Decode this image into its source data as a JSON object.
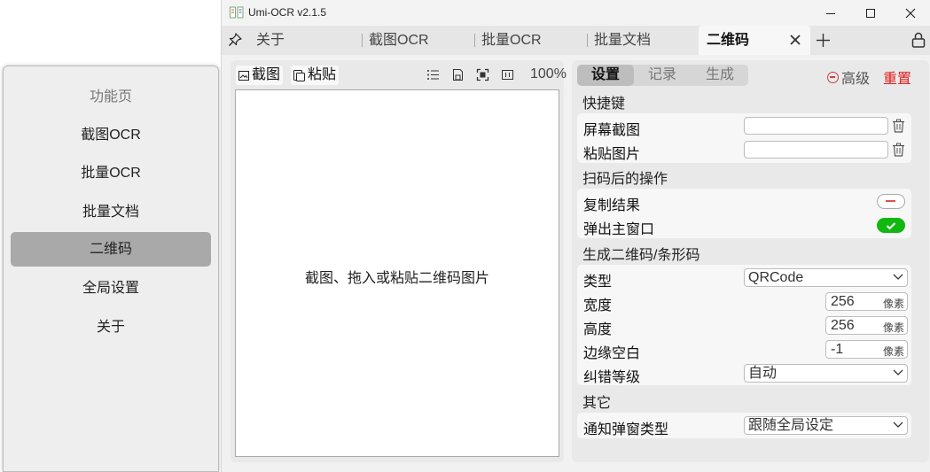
{
  "side_menu": {
    "title": "功能页",
    "items": [
      {
        "label": "截图OCR"
      },
      {
        "label": "批量OCR"
      },
      {
        "label": "批量文档"
      },
      {
        "label": "二维码"
      },
      {
        "label": "全局设置"
      },
      {
        "label": "关于"
      }
    ],
    "active": "二维码"
  },
  "window": {
    "title": "Umi-OCR v2.1.5",
    "tabs": [
      {
        "label": "关于"
      },
      {
        "label": "截图OCR"
      },
      {
        "label": "批量OCR"
      },
      {
        "label": "批量文档"
      }
    ],
    "active_tab": "二维码"
  },
  "left_panel": {
    "screenshot_label": "截图",
    "paste_label": "粘贴",
    "zoom": "100%",
    "hint": "截图、拖入或粘贴二维码图片"
  },
  "right_panel": {
    "tabs": [
      {
        "label": "设置"
      },
      {
        "label": "记录"
      },
      {
        "label": "生成"
      }
    ],
    "advanced_label": "高级",
    "reset_label": "重置",
    "sections": {
      "hotkeys": {
        "title": "快捷键",
        "screenshot": "屏幕截图",
        "paste_image": "粘贴图片"
      },
      "after_scan": {
        "title": "扫码后的操作",
        "copy_result": "复制结果",
        "popup_main": "弹出主窗口"
      },
      "generate": {
        "title": "生成二维码/条形码",
        "type_label": "类型",
        "type_value": "QRCode",
        "width_label": "宽度",
        "width_value": "256",
        "height_label": "高度",
        "height_value": "256",
        "margin_label": "边缘空白",
        "margin_value": "-1",
        "unit": "像素",
        "ec_label": "纠错等级",
        "ec_value": "自动"
      },
      "other": {
        "title": "其它",
        "notify_label": "通知弹窗类型",
        "notify_value": "跟随全局设定"
      }
    }
  },
  "colors": {
    "accent_red": "#e02020",
    "switch_on": "#10b810"
  }
}
